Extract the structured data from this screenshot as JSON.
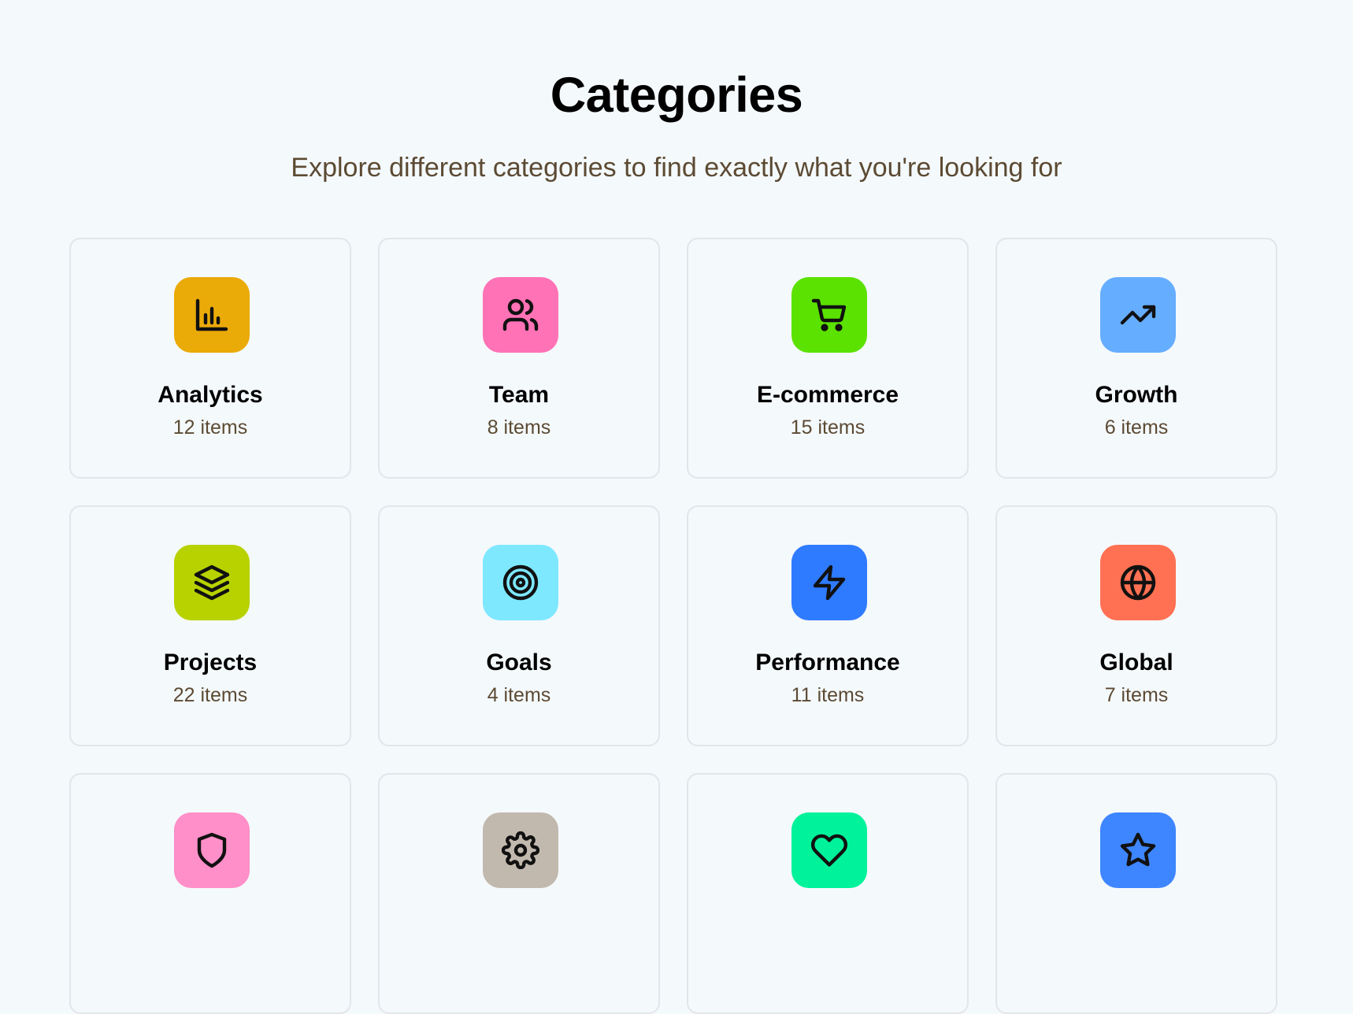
{
  "header": {
    "title": "Categories",
    "subtitle": "Explore different categories to find exactly what you're looking for"
  },
  "categories": [
    {
      "name": "Analytics",
      "count": "12 items",
      "color": "#EAAA08",
      "icon": "bar-chart-icon"
    },
    {
      "name": "Team",
      "count": "8 items",
      "color": "#FF72B6",
      "icon": "users-icon"
    },
    {
      "name": "E-commerce",
      "count": "15 items",
      "color": "#5BE200",
      "icon": "shopping-cart-icon"
    },
    {
      "name": "Growth",
      "count": "6 items",
      "color": "#65ADFF",
      "icon": "trending-up-icon"
    },
    {
      "name": "Projects",
      "count": "22 items",
      "color": "#B8D200",
      "icon": "layers-icon"
    },
    {
      "name": "Goals",
      "count": "4 items",
      "color": "#7EE8FF",
      "icon": "target-icon"
    },
    {
      "name": "Performance",
      "count": "11 items",
      "color": "#2F7BFF",
      "icon": "lightning-icon"
    },
    {
      "name": "Global",
      "count": "7 items",
      "color": "#FF7152",
      "icon": "globe-icon"
    },
    {
      "name": "",
      "count": "",
      "color": "#FF8FC8",
      "icon": "shield-icon"
    },
    {
      "name": "",
      "count": "",
      "color": "#C2B9AE",
      "icon": "gear-icon"
    },
    {
      "name": "",
      "count": "",
      "color": "#00F29A",
      "icon": "heart-icon"
    },
    {
      "name": "",
      "count": "",
      "color": "#3E86FF",
      "icon": "star-icon"
    }
  ]
}
